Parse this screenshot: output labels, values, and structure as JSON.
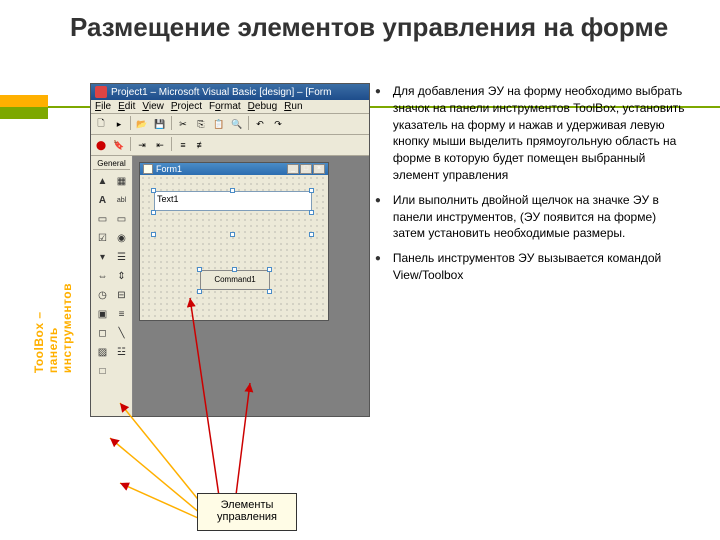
{
  "slide": {
    "title": "Размещение элементов управления на форме"
  },
  "sidebar_label": "ToolBox – панель инструментов",
  "vb": {
    "title": "Project1 – Microsoft Visual Basic [design] – [Form",
    "menu": {
      "file": "File",
      "edit": "Edit",
      "view": "View",
      "project": "Project",
      "format": "Format",
      "debug": "Debug",
      "run": "Run"
    },
    "toolbox_header": "General",
    "tools": {
      "pointer": "▲",
      "pictbox": "▦",
      "label": "A",
      "textbox": "abl",
      "frame": "▭",
      "button": "▭",
      "checkbox": "☑",
      "radio": "◉",
      "combo": "▾",
      "listbox": "☰",
      "hscroll": "⇔",
      "vscroll": "⇕",
      "timer": "◷",
      "drive": "⊟",
      "dir": "▣",
      "file": "≡",
      "shape": "◻",
      "line": "╲",
      "image": "▨",
      "data": "☳",
      "ole": "□"
    },
    "form": {
      "title": "Form1",
      "textbox_value": "Text1",
      "button_label": "Command1"
    }
  },
  "callout": "Элементы управления",
  "bullets": {
    "b1": "Для добавления ЭУ на форму необходимо выбрать значок на панели инструментов ToolBox, установить указатель на форму и нажав и удерживая левую кнопку мыши выделить прямоугольную область на форме  в которую будет помещен выбранный элемент управления",
    "b2": "Или выполнить двойной щелчок на значке ЭУ в панели инструментов, (ЭУ появится на форме) затем установить необходимые размеры.",
    "b3": "Панель инструментов ЭУ вызывается командой View/Toolbox"
  }
}
